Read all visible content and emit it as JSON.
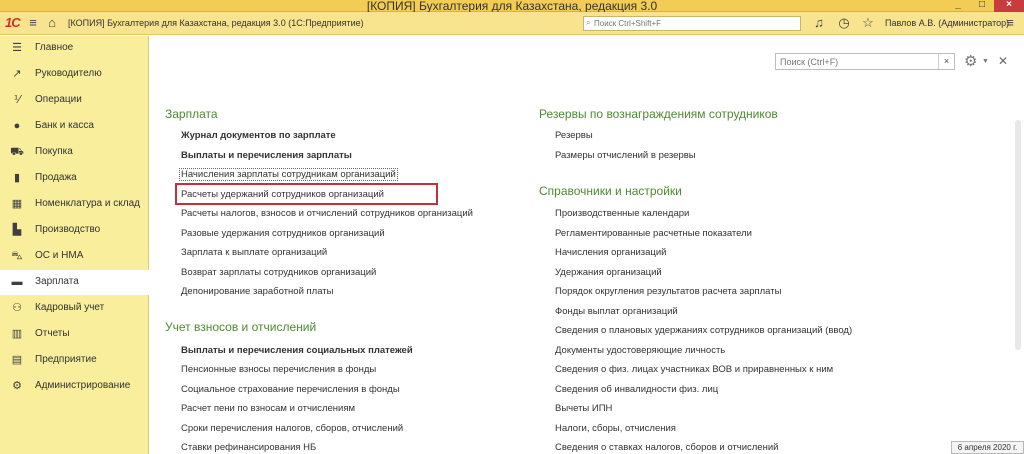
{
  "os": {
    "title": "[КОПИЯ] Бухгалтерия для Казахстана, редакция 3.0",
    "buttons": [
      "_",
      "□",
      "×"
    ]
  },
  "app": {
    "logo": "1С",
    "title": "[КОПИЯ] Бухгалтерия для Казахстана, редакция 3.0  (1С:Предприятие)",
    "search_placeholder": "Поиск Ctrl+Shift+F",
    "user": "Павлов А.В. (Администратор)"
  },
  "sidebar": {
    "items": [
      {
        "label": "Главное",
        "icon": "menu-icon"
      },
      {
        "label": "Руководителю",
        "icon": "chart-icon"
      },
      {
        "label": "Операции",
        "icon": "operations-icon"
      },
      {
        "label": "Банк и касса",
        "icon": "coins-icon"
      },
      {
        "label": "Покупка",
        "icon": "cart-icon"
      },
      {
        "label": "Продажа",
        "icon": "bag-icon"
      },
      {
        "label": "Номенклатура и склад",
        "icon": "warehouse-icon"
      },
      {
        "label": "Производство",
        "icon": "factory-icon"
      },
      {
        "label": "ОС и НМА",
        "icon": "car-icon"
      },
      {
        "label": "Зарплата",
        "icon": "wallet-icon"
      },
      {
        "label": "Кадровый учет",
        "icon": "people-icon"
      },
      {
        "label": "Отчеты",
        "icon": "report-icon"
      },
      {
        "label": "Предприятие",
        "icon": "building-icon"
      },
      {
        "label": "Администрирование",
        "icon": "gear-icon"
      }
    ]
  },
  "content": {
    "search_placeholder": "Поиск (Ctrl+F)",
    "left": {
      "section1_title": "Зарплата",
      "section1_links": [
        "Журнал документов по зарплате",
        "Выплаты и перечисления зарплаты",
        "Начисления зарплаты сотрудникам организаций",
        "Расчеты удержаний сотрудников организаций",
        "Расчеты налогов, взносов и отчислений сотрудников организаций",
        "Разовые удержания сотрудников организаций",
        "Зарплата к выплате организаций",
        "Возврат зарплаты сотрудников организаций",
        "Депонирование заработной платы"
      ],
      "section2_title": "Учет взносов и отчислений",
      "section2_links": [
        "Выплаты и перечисления социальных платежей",
        "Пенсионные взносы перечисления в фонды",
        "Социальное страхование перечисления в фонды",
        "Расчет пени по взносам и отчислениям",
        "Сроки перечисления налогов, сборов, отчислений",
        "Ставки рефинансирования НБ"
      ]
    },
    "right": {
      "section1_title": "Резервы по вознаграждениям сотрудников",
      "section1_links": [
        "Резервы",
        "Размеры отчислений в резервы"
      ],
      "section2_title": "Справочники и настройки",
      "section2_links": [
        "Производственные календари",
        "Регламентированные расчетные показатели",
        "Начисления организаций",
        "Удержания организаций",
        "Порядок округления результатов расчета зарплаты",
        "Фонды выплат организаций",
        "Сведения о плановых удержаниях сотрудников организаций (ввод)",
        "Документы удостоверяющие личность",
        "Сведения о физ. лицах участниках ВОВ и приравненных к ним",
        "Сведения об инвалидности физ. лиц",
        "Вычеты ИПН",
        "Налоги, сборы, отчисления",
        "Сведения о ставках налогов, сборов и отчислений"
      ]
    }
  },
  "status": {
    "date_tip": "6 апреля 2020 г."
  }
}
